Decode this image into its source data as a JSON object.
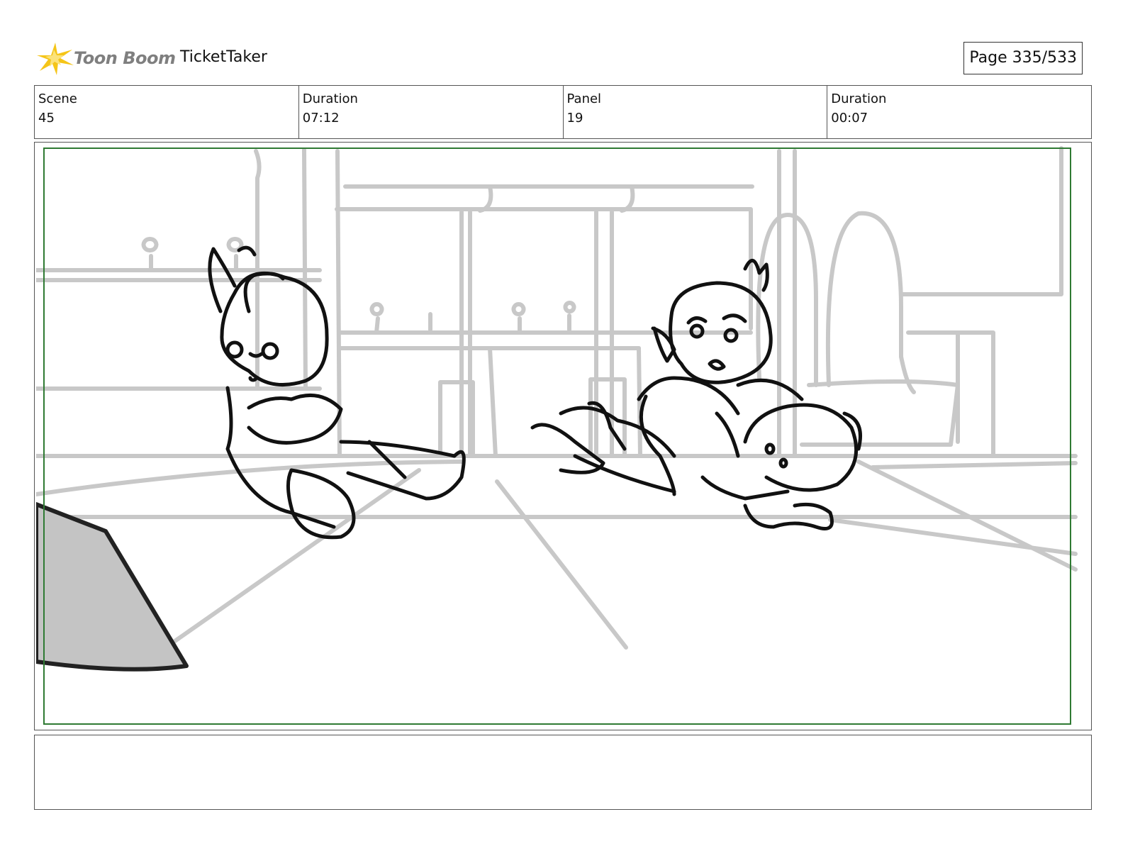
{
  "header": {
    "logo_text": "Toon Boom",
    "project_name": "TicketTaker",
    "page_indicator": "Page 335/533"
  },
  "info": {
    "scene_label": "Scene",
    "scene_value": "45",
    "scene_duration_label": "Duration",
    "scene_duration_value": "07:12",
    "panel_label": "Panel",
    "panel_value": "19",
    "panel_duration_label": "Duration",
    "panel_duration_value": "00:07"
  },
  "colors": {
    "logo_star": "#f5c518",
    "logo_text": "#7f7f7f",
    "safe_frame": "#2f7a33",
    "background_sketch": "#c8c8c8",
    "foreground_fill": "#c4c4c4"
  },
  "notes": {
    "text": ""
  }
}
